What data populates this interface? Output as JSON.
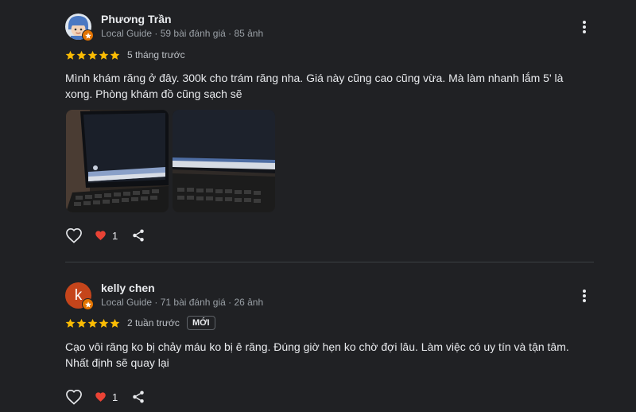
{
  "reviews": [
    {
      "name": "Phương Trần",
      "meta": "Local Guide · 59 bài đánh giá · 85 ảnh",
      "rating": 5,
      "time": "5 tháng trước",
      "text": "Mình khám răng ở đây. 300k cho trám răng nha. Giá này cũng cao cũng vừa. Mà làm nhanh lắm 5' là xong. Phòng khám đồ cũng sạch sẽ",
      "heart_count": "1",
      "avatar": "cartoon-avatar",
      "photos": [
        "laptop-photo-1",
        "laptop-photo-2"
      ]
    },
    {
      "name": "kelly chen",
      "meta": "Local Guide · 71 bài đánh giá · 26 ảnh",
      "rating": 5,
      "time": "2 tuần trước",
      "badge": "MỚI",
      "text": "Cạo vôi răng ko bị chảy máu ko bị ê răng. Đúng giờ hẹn ko chờ đợi lâu. Làm việc có uy tín và tận tâm. Nhất định sẽ quay lại",
      "heart_count": "1",
      "avatar_letter": "k"
    }
  ],
  "colors": {
    "background": "#202124",
    "star": "#fbbc04",
    "heart": "#ea4335",
    "guide_badge": "#e37400",
    "avatar_kelly": "#c5451b"
  }
}
